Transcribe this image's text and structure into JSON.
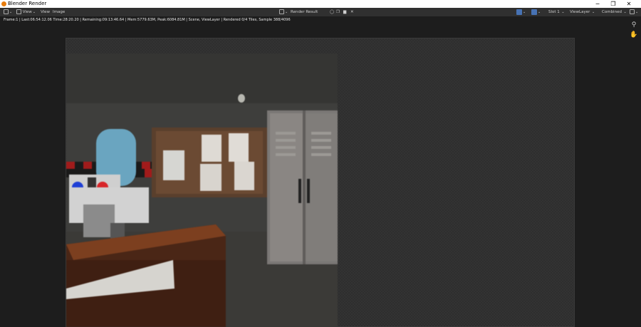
{
  "window": {
    "title": "Blender Render"
  },
  "window_controls": {
    "minimize": "─",
    "maximize": "❐",
    "close": "✕"
  },
  "header": {
    "menu": [
      "View",
      "View",
      "Image"
    ],
    "image_name": "Render Result",
    "slot": "Slot 1",
    "view_layer": "ViewLayer",
    "pass": "Combined"
  },
  "status": {
    "text": "Frame:1 | Last:06:54:12.06 Time:28:20.20 | Remaining:09:13:46.64 | Mem:5779.63M, Peak:6084.81M | Scene, ViewLayer | Rendered 0/4 Tiles, Sample 388/4096"
  },
  "colors": {
    "accent": "#4772b3",
    "header_bg": "#303030",
    "editor_bg": "#1d1d1d"
  },
  "icons": {
    "editor_type": "image-editor-icon",
    "zoom": "zoom-icon",
    "pan": "hand-icon"
  }
}
